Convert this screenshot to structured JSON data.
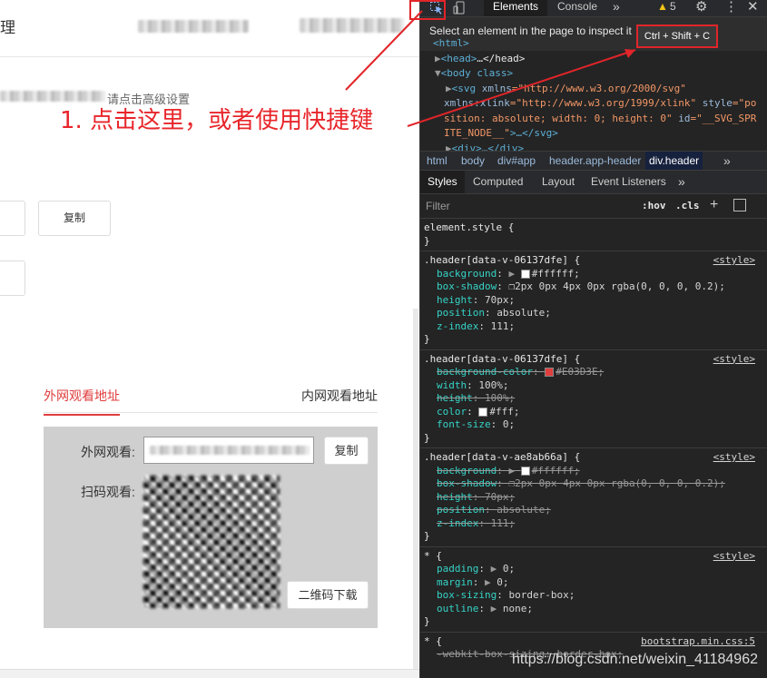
{
  "webpage": {
    "brand_char": "理",
    "hint_suffix": "请点击高级设置",
    "copy_button_top": "复制",
    "tabs": {
      "external": "外网观看地址",
      "internal": "内网观看地址"
    },
    "external_label": "外网观看:",
    "copy_button": "复制",
    "qr_label": "扫码观看:",
    "qr_download": "二维码下载"
  },
  "annotation": {
    "text": "1. 点击这里，或者使用快捷键",
    "color": "#e8262b"
  },
  "devtools": {
    "tabs": [
      "Elements",
      "Console"
    ],
    "more": "»",
    "warning_count": "5",
    "inspect_tip": "Select an element in the page to inspect it",
    "shortcut": "Ctrl + Shift + C",
    "breadcrumbs": [
      "html",
      "body",
      "div#app",
      "header.app-header",
      "div.header"
    ],
    "subtabs": [
      "Styles",
      "Computed",
      "Layout",
      "Event Listeners"
    ],
    "filter_placeholder": "Filter",
    "hov": ":hov",
    "cls": ".cls",
    "dom_lines": {
      "l0": "<html>",
      "l1_tag": "<head>",
      "l1_rest": "…</head>",
      "l2": "<body class>",
      "l3a": "<svg ",
      "l3b": "xmlns",
      "l3c": "=\"http://www.w3.org/2000/svg\"",
      "l4a": "xmlns:xlink",
      "l4b": "=\"http://www.w3.org/1999/xlink\"",
      "l4c": " style",
      "l4d": "=\"po",
      "l5": "sition: absolute; width: 0; height: 0\"",
      "l5b": " id",
      "l5c": "=\"__SVG_SPR",
      "l6a": "ITE_NODE__\"",
      "l6b": ">…</svg>",
      "l7": "<div>…</div>"
    },
    "styles": {
      "element_style": "element.style {",
      "close": "}",
      "r1_selector": ".header[data-v-06137dfe] {",
      "r1_source": "<style>",
      "r1_lines": [
        {
          "p": "background",
          "v": "#ffffff;"
        },
        {
          "p": "box-shadow",
          "v": "2px 0px 4px 0px rgba(0, 0, 0, 0.2);"
        },
        {
          "p": "height",
          "v": "70px;"
        },
        {
          "p": "position",
          "v": "absolute;"
        },
        {
          "p": "z-index",
          "v": "111;"
        }
      ],
      "r2_selector": ".header[data-v-06137dfe] {",
      "r2_source": "<style>",
      "r2_lines": [
        {
          "p": "background-color",
          "v": "#E03D3E;"
        },
        {
          "p": "width",
          "v": "100%;"
        },
        {
          "p": "height",
          "v": "100%;"
        },
        {
          "p": "color",
          "v": "#fff;"
        },
        {
          "p": "font-size",
          "v": "0;"
        }
      ],
      "r3_selector": ".header[data-v-ae8ab66a] {",
      "r3_source": "<style>",
      "r3_lines": [
        {
          "p": "background",
          "v": "#ffffff;"
        },
        {
          "p": "box-shadow",
          "v": "2px 0px 4px 0px rgba(0, 0, 0, 0.2);"
        },
        {
          "p": "height",
          "v": "70px;"
        },
        {
          "p": "position",
          "v": "absolute;"
        },
        {
          "p": "z-index",
          "v": "111;"
        }
      ],
      "r4_selector": "* {",
      "r4_source": "<style>",
      "r4_lines": [
        {
          "p": "padding",
          "v": "0;"
        },
        {
          "p": "margin",
          "v": "0;"
        },
        {
          "p": "box-sizing",
          "v": "border-box;"
        },
        {
          "p": "outline",
          "v": "none;"
        }
      ],
      "r5_selector": "* {",
      "r5_source": "bootstrap.min.css:5",
      "r5_line": "-webkit-box-sizing: border-box;"
    }
  },
  "watermark": "https://blog.csdn.net/weixin_41184962",
  "colors": {
    "accent_red": "#e03d3e",
    "devtools_bg": "#242424",
    "swatch_red": "#E03D3E"
  }
}
